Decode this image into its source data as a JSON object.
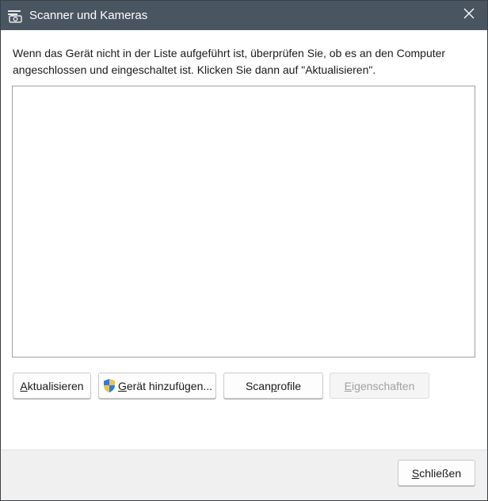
{
  "window": {
    "title": "Scanner und Kameras",
    "icon": "scanner-camera-icon",
    "close_icon": "close-icon"
  },
  "instruction": {
    "line1": "Wenn das Gerät nicht in der Liste aufgeführt ist, überprüfen Sie, ob es an den Computer",
    "line2": "angeschlossen und eingeschaltet ist. Klicken Sie dann auf \"Aktualisieren\"."
  },
  "device_list": {
    "items": []
  },
  "buttons": {
    "refresh": {
      "pre": "",
      "mnemonic": "A",
      "post": "ktualisieren"
    },
    "add_device": {
      "pre": "",
      "mnemonic": "G",
      "post": "erät hinzufügen...",
      "icon": "uac-shield-icon"
    },
    "scan_profiles": {
      "pre": "Scan",
      "mnemonic": "p",
      "post": "rofile"
    },
    "properties": {
      "pre": "",
      "mnemonic": "E",
      "post": "igenschaften",
      "enabled": false
    }
  },
  "footer": {
    "close": {
      "pre": "",
      "mnemonic": "S",
      "post": "chließen"
    }
  },
  "colors": {
    "titlebar": "#4a5562",
    "footer": "#f0f0f0",
    "disabled_text": "#a0a0a0"
  }
}
